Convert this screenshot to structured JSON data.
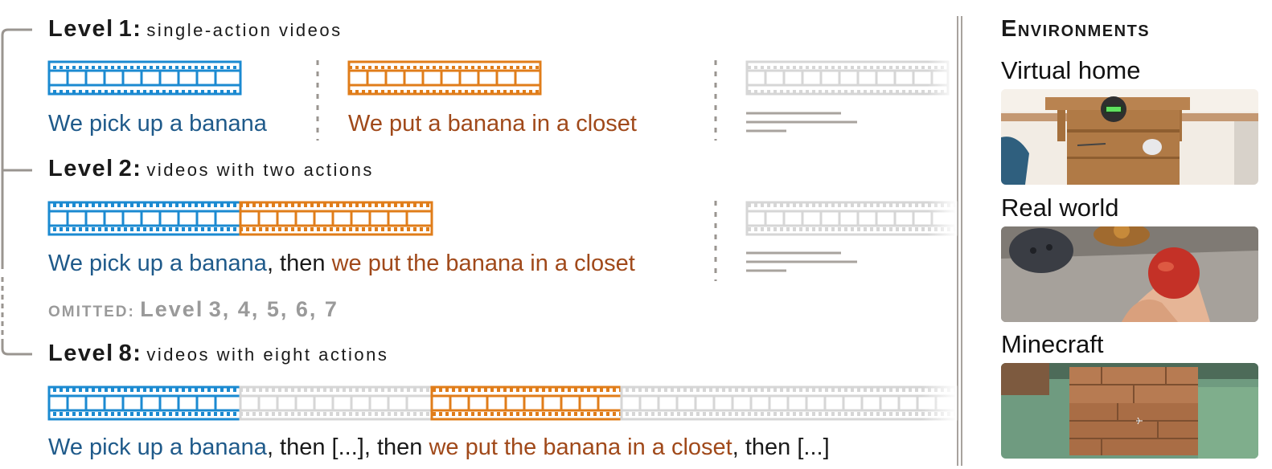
{
  "levels": [
    {
      "title_word": "Level",
      "title_num": "1:",
      "title_rest": "single-action videos"
    },
    {
      "title_word": "Level",
      "title_num": "2:",
      "title_rest": "videos with two actions"
    },
    {
      "title_word": "Level",
      "title_num": "8:",
      "title_rest": "videos with eight actions"
    }
  ],
  "level1": {
    "caption_blue": "We pick up a banana",
    "caption_orange": "We put a banana in a closet"
  },
  "level2": {
    "caption_blue": "We pick up a banana",
    "caption_mid": ", then ",
    "caption_orange": "we put the banana in a closet"
  },
  "omitted": {
    "prefix": "omitted:",
    "word": "Level",
    "nums": "3, 4, 5, 6, 7"
  },
  "level8": {
    "caption_blue": "We pick up a banana",
    "caption_mid1": ", then [...], then ",
    "caption_orange": "we put the banana in a closet",
    "caption_end": ", then [...]"
  },
  "environments": {
    "title": "Environments",
    "items": [
      {
        "label": "Virtual home"
      },
      {
        "label": "Real world"
      },
      {
        "label": "Minecraft"
      }
    ]
  },
  "colors": {
    "blue": "#1b8ad1",
    "orange": "#e07d1a",
    "gray": "#d0d0d0",
    "dark_gray": "#9a9590"
  }
}
